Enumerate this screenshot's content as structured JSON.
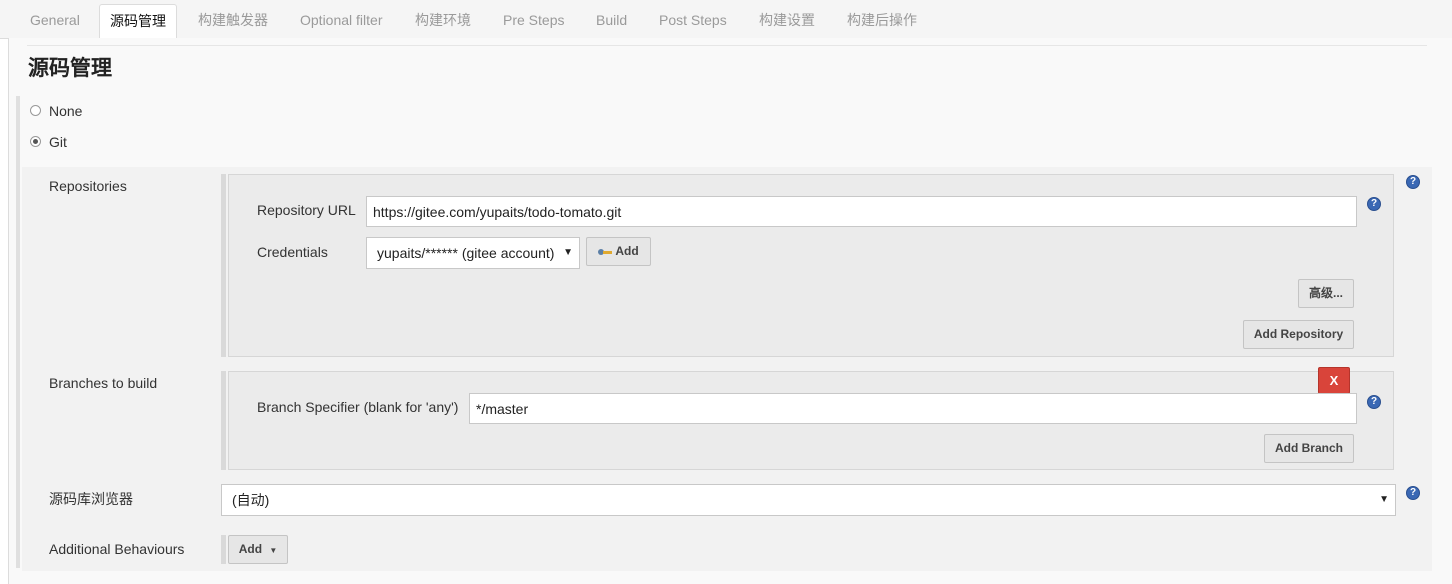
{
  "tabs": [
    {
      "label": "General",
      "active": false
    },
    {
      "label": "源码管理",
      "active": true
    },
    {
      "label": "构建触发器",
      "active": false
    },
    {
      "label": "Optional filter",
      "active": false
    },
    {
      "label": "构建环境",
      "active": false
    },
    {
      "label": "Pre Steps",
      "active": false
    },
    {
      "label": "Build",
      "active": false
    },
    {
      "label": "Post Steps",
      "active": false
    },
    {
      "label": "构建设置",
      "active": false
    },
    {
      "label": "构建后操作",
      "active": false
    }
  ],
  "section": {
    "title": "源码管理"
  },
  "scm": {
    "options": [
      {
        "label": "None",
        "selected": false
      },
      {
        "label": "Git",
        "selected": true
      }
    ]
  },
  "git": {
    "repositories": {
      "label": "Repositories",
      "url_label": "Repository URL",
      "url_value": "https://gitee.com/yupaits/todo-tomato.git",
      "credentials_label": "Credentials",
      "credentials_value": "yupaits/****** (gitee account)",
      "add_credentials_label": "Add",
      "advanced_label": "高级...",
      "add_repository_label": "Add Repository"
    },
    "branches": {
      "label": "Branches to build",
      "specifier_label": "Branch Specifier (blank for 'any')",
      "specifier_value": "*/master",
      "delete_label": "X",
      "add_branch_label": "Add Branch"
    },
    "browser": {
      "label": "源码库浏览器",
      "value": "(自动)"
    },
    "behaviours": {
      "label": "Additional Behaviours",
      "add_label": "Add"
    }
  },
  "help_icon_text": "?",
  "colors": {
    "help_icon": "#3a68b4",
    "delete_button": "#d9443a",
    "tab_active_text": "#111111",
    "tab_inactive_text": "#9a9a9a"
  }
}
